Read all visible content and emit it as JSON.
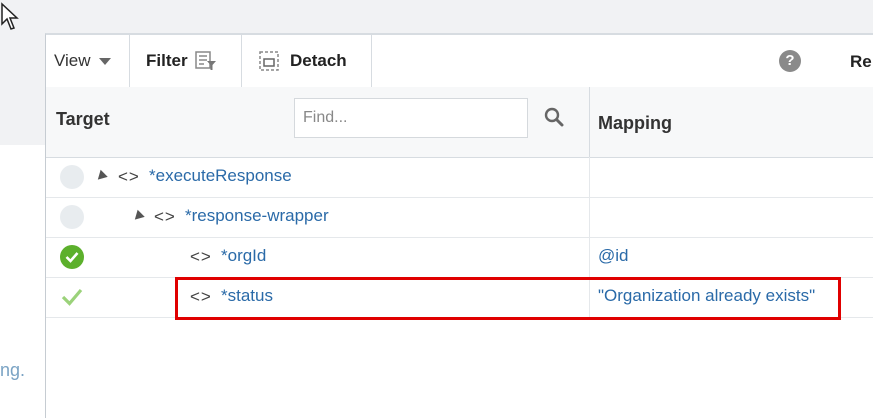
{
  "toolbar": {
    "view_label": "View",
    "filter_label": "Filter",
    "detach_label": "Detach",
    "help_glyph": "?",
    "right_partial_label": "Re"
  },
  "header": {
    "target_label": "Target",
    "find_placeholder": "Find...",
    "mapping_label": "Mapping"
  },
  "left_fragment": "ng.",
  "rows": [
    {
      "name": "*executeResponse",
      "status": "none",
      "expanded": true,
      "mapping": ""
    },
    {
      "name": "*response-wrapper",
      "status": "none",
      "expanded": true,
      "mapping": ""
    },
    {
      "name": "*orgId",
      "status": "mapped",
      "mapping": "@id"
    },
    {
      "name": "*status",
      "status": "mapped-check",
      "mapping": "\"Organization already exists\""
    }
  ],
  "colors": {
    "link": "#2a6aa8",
    "success": "#5cb02c",
    "highlight": "#e00000"
  }
}
